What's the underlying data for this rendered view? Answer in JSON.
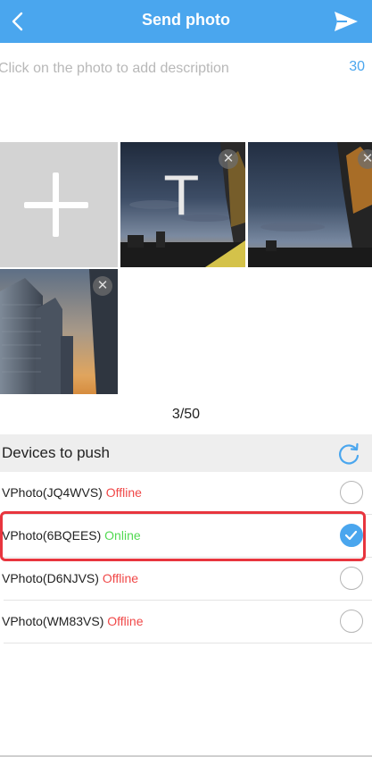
{
  "header": {
    "title": "Send photo",
    "back_icon": "chevron-left-icon",
    "send_icon": "paper-plane-icon",
    "background": "#4aa6ee"
  },
  "description": {
    "placeholder": "Click on the photo to add description",
    "remaining": "30"
  },
  "photos": {
    "add_icon": "plus-icon",
    "items": [
      {
        "overlay_text": "T",
        "remove_icon": "close-icon"
      },
      {
        "remove_icon": "close-icon"
      },
      {
        "remove_icon": "close-icon"
      }
    ],
    "count": "3/50"
  },
  "devices": {
    "title": "Devices to push",
    "refresh_icon": "refresh-icon",
    "list": [
      {
        "name": "VPhoto(JQ4WVS)",
        "status": "Offline",
        "selected": false
      },
      {
        "name": "VPhoto(6BQEES)",
        "status": "Online",
        "selected": true
      },
      {
        "name": "VPhoto(D6NJVS)",
        "status": "Offline",
        "selected": false
      },
      {
        "name": "VPhoto(WM83VS)",
        "status": "Offline",
        "selected": false
      }
    ]
  },
  "colors": {
    "accent": "#4aa6ee",
    "offline": "#f04848",
    "online": "#52d952",
    "highlight": "#e8353e"
  }
}
